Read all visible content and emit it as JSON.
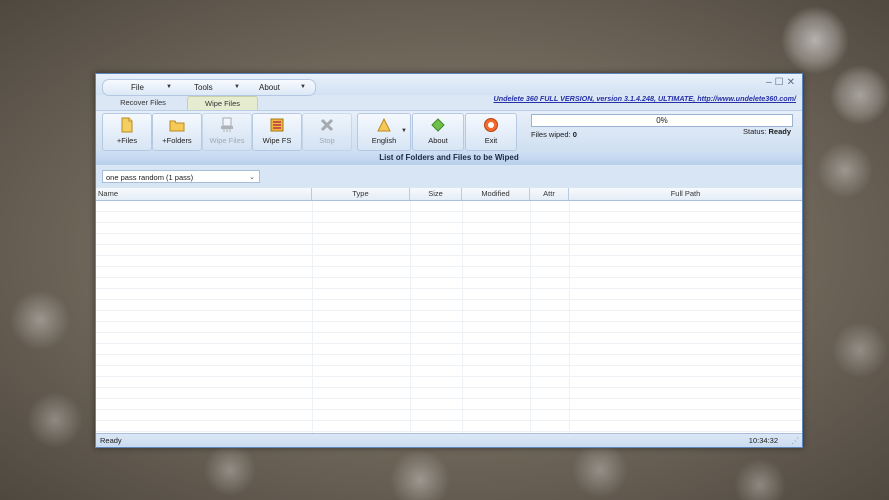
{
  "menu": [
    {
      "label": "File"
    },
    {
      "label": "Tools"
    },
    {
      "label": "About"
    }
  ],
  "tabs": [
    {
      "label": "Recover Files",
      "active": false
    },
    {
      "label": "Wipe Files",
      "active": true
    }
  ],
  "product_link": "Undelete 360 FULL VERSION, version 3.1.4.248, ULTIMATE, http://www.undelete360.com/",
  "toolbar": {
    "add_files": "+Files",
    "add_folders": "+Folders",
    "wipe_files": "Wipe Files",
    "wipe_fs": "Wipe FS",
    "stop": "Stop",
    "language": "English",
    "about": "About",
    "exit": "Exit"
  },
  "progress": {
    "text": "0%",
    "value": 0
  },
  "files_wiped": {
    "label": "Files wiped:",
    "value": "0"
  },
  "status": {
    "label": "Status:",
    "value": "Ready"
  },
  "section_title": "List of Folders and Files to be Wiped",
  "wipe_method": {
    "selected": "one pass random (1 pass)"
  },
  "columns": [
    "Name",
    "Type",
    "Size",
    "Modified",
    "Attr",
    "Full Path"
  ],
  "statusbar": {
    "left": "Ready",
    "time": "10:34:32"
  },
  "colors": {
    "accent": "#5d86bf",
    "link": "#2530a8",
    "window_bg": "#dbe7f5"
  }
}
